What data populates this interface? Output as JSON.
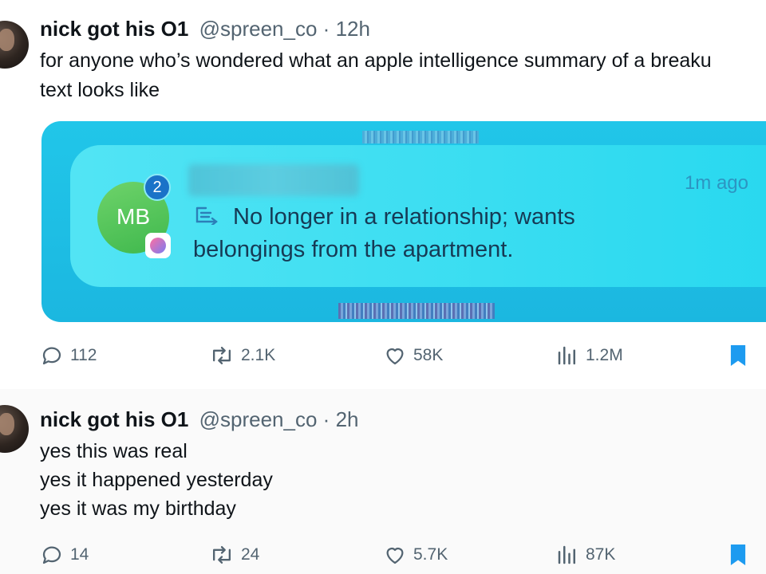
{
  "tweets": [
    {
      "name": "nick got his O1",
      "handle": "@spreen_co",
      "separator": "·",
      "time": "12h",
      "text": "for anyone who’s wondered what an apple intelligence summary of a breaku\ntext looks like",
      "embed": {
        "initials": "MB",
        "badge": "2",
        "notification_time": "1m ago",
        "summary": "No longer in a relationship; wants belongings from the apartment."
      },
      "stats": {
        "replies": "112",
        "reposts": "2.1K",
        "likes": "58K",
        "views": "1.2M"
      }
    },
    {
      "name": "nick got his O1",
      "handle": "@spreen_co",
      "separator": "·",
      "time": "2h",
      "text": "yes this was real\nyes it happened yesterday\nyes it was my birthday",
      "stats": {
        "replies": "14",
        "reposts": "24",
        "likes": "5.7K",
        "views": "87K"
      }
    }
  ],
  "icons": {
    "reply": "reply-icon",
    "repost": "repost-icon",
    "like": "heart-icon",
    "views": "views-icon",
    "bookmark": "bookmark-icon",
    "summary": "summary-icon",
    "app": "messaging-app-icon"
  },
  "colors": {
    "accent": "#1d9bf0",
    "muted": "#536471",
    "embed_background": "#21c6e9"
  }
}
